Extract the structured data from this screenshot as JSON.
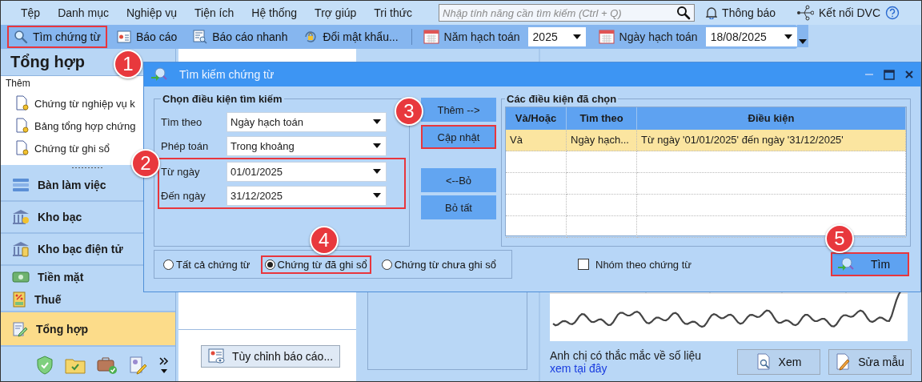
{
  "menu_bar": {
    "items": [
      "Tệp",
      "Danh mục",
      "Nghiệp vụ",
      "Tiện ích",
      "Hệ thống",
      "Trợ giúp",
      "Tri thức"
    ],
    "search": {
      "placeholder": "Nhập tính năng cần tìm kiếm (Ctrl + Q)"
    },
    "notifications": "Thông báo",
    "connect": "Kết nối DVC"
  },
  "toolbar": {
    "items": [
      {
        "label": "Tìm chứng từ",
        "highlighted": true,
        "callout": "1"
      },
      {
        "label": "Báo cáo",
        "highlighted": false
      },
      {
        "label": "Báo cáo nhanh",
        "highlighted": false
      },
      {
        "label": "Đổi mật khẩu...",
        "highlighted": false
      }
    ],
    "year_label": "Năm hạch toán",
    "year": "2025",
    "date_label": "Ngày hạch toán",
    "date": "18/08/2025"
  },
  "sidebar": {
    "title": "Tổng hợp",
    "add_label": "Thêm",
    "documents": [
      "Chứng từ nghiệp vụ k",
      "Bảng tổng hợp chứng",
      "Chứng từ ghi sổ"
    ],
    "nav": [
      {
        "label": "Bàn làm việc",
        "selected": false,
        "kind": "full"
      },
      {
        "label": "Kho bạc",
        "selected": false,
        "kind": "full"
      },
      {
        "label": "Kho bạc điện tử",
        "selected": false,
        "kind": "full"
      },
      {
        "label": "Tiền mặt",
        "selected": false,
        "kind": "compact"
      },
      {
        "label": "Thuế",
        "selected": false,
        "kind": "compact"
      },
      {
        "label": "Tổng hợp",
        "selected": true,
        "kind": "full"
      }
    ]
  },
  "content": {
    "customize_button": "Tùy chỉnh báo cáo...",
    "question": "Anh chị có thắc mắc về số liệu",
    "link": "xem tại đây",
    "view_button": "Xem",
    "edit_button": "Sửa mẫu"
  },
  "dialog": {
    "title": "Tìm kiếm chứng từ",
    "criteria": {
      "title": "Chọn điều kiện tìm kiếm",
      "fields": [
        {
          "label": "Tìm theo",
          "value": "Ngày hạch toán",
          "highlighted": false
        },
        {
          "label": "Phép toán",
          "value": "Trong khoảng",
          "highlighted": false
        },
        {
          "label": "Từ ngày",
          "value": "01/01/2025",
          "highlighted": true,
          "callout": "2"
        },
        {
          "label": "Đến ngày",
          "value": "31/12/2025",
          "highlighted": true
        }
      ]
    },
    "actions": [
      {
        "label": "Thêm -->",
        "highlighted": false
      },
      {
        "label": "Cập nhật",
        "highlighted": true,
        "callout": "3"
      },
      {
        "label": "<--Bỏ",
        "highlighted": false
      },
      {
        "label": "Bỏ tất",
        "highlighted": false
      }
    ],
    "selected_conditions": {
      "title": "Các điều kiện đã chọn",
      "columns": [
        "Và/Hoặc",
        "Tìm theo",
        "Điều kiện"
      ],
      "rows": [
        {
          "cells": [
            "Và",
            "Ngày hạch...",
            "Từ ngày '01/01/2025' đến ngày '31/12/2025'"
          ],
          "selected": true
        }
      ]
    },
    "scope": [
      {
        "label": "Tất cả chứng từ",
        "selected": false,
        "highlighted": false
      },
      {
        "label": "Chứng từ đã ghi sổ",
        "selected": true,
        "highlighted": true,
        "callout": "4"
      },
      {
        "label": "Chứng từ chưa ghi sổ",
        "selected": false,
        "highlighted": false
      }
    ],
    "group_by": {
      "label": "Nhóm theo chứng từ",
      "checked": false
    },
    "search_button": {
      "label": "Tìm",
      "highlighted": true,
      "callout": "5"
    }
  }
}
